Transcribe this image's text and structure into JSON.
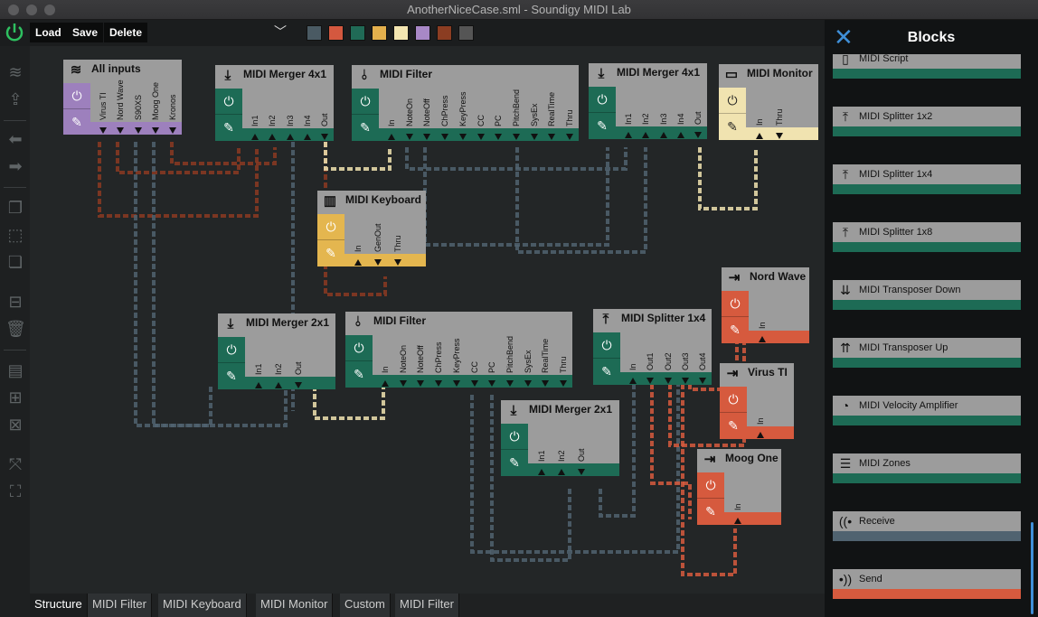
{
  "window": {
    "title": "AnotherNiceCase.sml - Soundigy MIDI Lab"
  },
  "toolbar": {
    "load": "Load",
    "save": "Save",
    "delete": "Delete",
    "preset_value": "",
    "colors": [
      "#4a5a63",
      "#d4583f",
      "#206a56",
      "#e3b04d",
      "#f3e6b1",
      "#a888c7",
      "#8b3d22",
      "#555555"
    ]
  },
  "colors": {
    "green": "#1d6b55",
    "purple": "#9d80bd",
    "yellow": "#e4b64f",
    "cream": "#f0e3b0",
    "red": "#d65a3e",
    "brown": "#8b3a22",
    "slate": "#506370"
  },
  "blocks": [
    {
      "title": "All inputs",
      "icon": "stack-icon",
      "color": "#9d80bd",
      "ports": [
        {
          "n": "Virus TI",
          "d": "out"
        },
        {
          "n": "Nord Wave",
          "d": "out"
        },
        {
          "n": "S90XS",
          "d": "out"
        },
        {
          "n": "Moog One",
          "d": "out"
        },
        {
          "n": "Kronos",
          "d": "out"
        }
      ]
    },
    {
      "title": "MIDI Merger 4x1",
      "icon": "merge-icon",
      "color": "#1d6b55",
      "ports": [
        {
          "n": "In1",
          "d": "in"
        },
        {
          "n": "In2",
          "d": "in"
        },
        {
          "n": "In3",
          "d": "in"
        },
        {
          "n": "In4",
          "d": "in"
        },
        {
          "n": "Out",
          "d": "out"
        }
      ]
    },
    {
      "title": "MIDI Filter",
      "icon": "filter-icon",
      "color": "#1d6b55",
      "ports": [
        {
          "n": "In",
          "d": "in"
        },
        {
          "n": "NoteOn",
          "d": "out"
        },
        {
          "n": "NoteOff",
          "d": "out"
        },
        {
          "n": "ChPress",
          "d": "out"
        },
        {
          "n": "KeyPress",
          "d": "out"
        },
        {
          "n": "CC",
          "d": "out"
        },
        {
          "n": "PC",
          "d": "out"
        },
        {
          "n": "PitchBend",
          "d": "out"
        },
        {
          "n": "SysEx",
          "d": "out"
        },
        {
          "n": "RealTime",
          "d": "out"
        },
        {
          "n": "Thru",
          "d": "out"
        }
      ]
    },
    {
      "title": "MIDI Merger 4x1",
      "icon": "merge-icon",
      "color": "#1d6b55",
      "ports": [
        {
          "n": "In1",
          "d": "in"
        },
        {
          "n": "In2",
          "d": "in"
        },
        {
          "n": "In3",
          "d": "in"
        },
        {
          "n": "In4",
          "d": "in"
        },
        {
          "n": "Out",
          "d": "out"
        }
      ]
    },
    {
      "title": "MIDI Monitor",
      "icon": "monitor-icon",
      "color": "#f0e3b0",
      "ports": [
        {
          "n": "In",
          "d": "in"
        },
        {
          "n": "Thru",
          "d": "out"
        }
      ]
    },
    {
      "title": "MIDI Keyboard",
      "icon": "piano-icon",
      "color": "#e4b64f",
      "ports": [
        {
          "n": "In",
          "d": "in"
        },
        {
          "n": "GenOut",
          "d": "out"
        },
        {
          "n": "Thru",
          "d": "out"
        }
      ]
    },
    {
      "title": "MIDI Merger 2x1",
      "icon": "merge-icon",
      "color": "#1d6b55",
      "ports": [
        {
          "n": "In1",
          "d": "in"
        },
        {
          "n": "In2",
          "d": "in"
        },
        {
          "n": "Out",
          "d": "out"
        }
      ]
    },
    {
      "title": "MIDI Filter",
      "icon": "filter-icon",
      "color": "#1d6b55",
      "ports": [
        {
          "n": "In",
          "d": "in"
        },
        {
          "n": "NoteOn",
          "d": "out"
        },
        {
          "n": "NoteOff",
          "d": "out"
        },
        {
          "n": "ChPress",
          "d": "out"
        },
        {
          "n": "KeyPress",
          "d": "out"
        },
        {
          "n": "CC",
          "d": "out"
        },
        {
          "n": "PC",
          "d": "out"
        },
        {
          "n": "PitchBend",
          "d": "out"
        },
        {
          "n": "SysEx",
          "d": "out"
        },
        {
          "n": "RealTime",
          "d": "out"
        },
        {
          "n": "Thru",
          "d": "out"
        }
      ]
    },
    {
      "title": "MIDI Splitter 1x4",
      "icon": "split-icon",
      "color": "#1d6b55",
      "ports": [
        {
          "n": "In",
          "d": "in"
        },
        {
          "n": "Out1",
          "d": "out"
        },
        {
          "n": "Out2",
          "d": "out"
        },
        {
          "n": "Out3",
          "d": "out"
        },
        {
          "n": "Out4",
          "d": "out"
        }
      ]
    },
    {
      "title": "MIDI Merger 2x1",
      "icon": "merge-icon",
      "color": "#1d6b55",
      "ports": [
        {
          "n": "In1",
          "d": "in"
        },
        {
          "n": "In2",
          "d": "in"
        },
        {
          "n": "Out",
          "d": "out"
        }
      ]
    },
    {
      "title": "Nord Wave",
      "icon": "output-icon",
      "color": "#d65a3e",
      "ports": [
        {
          "n": "In",
          "d": "in"
        }
      ]
    },
    {
      "title": "Virus TI",
      "icon": "output-icon",
      "color": "#d65a3e",
      "ports": [
        {
          "n": "In",
          "d": "in"
        }
      ]
    },
    {
      "title": "Moog One",
      "icon": "output-icon",
      "color": "#d65a3e",
      "ports": [
        {
          "n": "In",
          "d": "in"
        }
      ]
    }
  ],
  "bottom_tabs": [
    "Structure",
    "MIDI Filter",
    "MIDI Keyboard",
    "MIDI Monitor",
    "Custom",
    "MIDI Filter"
  ],
  "blocks_panel": {
    "title": "Blocks",
    "items": [
      {
        "label": "MIDI Script",
        "icon": "script-icon",
        "color": "#1d6b55"
      },
      {
        "label": "MIDI Splitter 1x2",
        "icon": "split-icon",
        "color": "#1d6b55"
      },
      {
        "label": "MIDI Splitter 1x4",
        "icon": "split-icon",
        "color": "#1d6b55"
      },
      {
        "label": "MIDI Splitter 1x8",
        "icon": "split-icon",
        "color": "#1d6b55"
      },
      {
        "label": "MIDI Transposer Down",
        "icon": "transpose-down-icon",
        "color": "#1d6b55"
      },
      {
        "label": "MIDI Transposer Up",
        "icon": "transpose-up-icon",
        "color": "#1d6b55"
      },
      {
        "label": "MIDI Velocity Amplifier",
        "icon": "gauge-icon",
        "color": "#1d6b55"
      },
      {
        "label": "MIDI Zones",
        "icon": "zones-icon",
        "color": "#1d6b55"
      },
      {
        "label": "Receive",
        "icon": "receive-icon",
        "color": "#506370"
      },
      {
        "label": "Send",
        "icon": "send-icon",
        "color": "#d65a3e"
      }
    ]
  }
}
